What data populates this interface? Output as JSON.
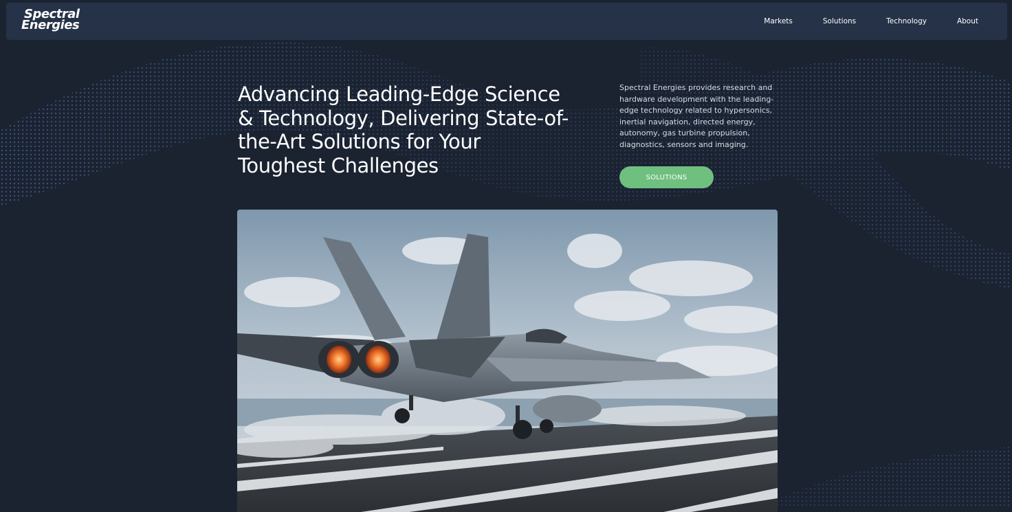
{
  "brand": {
    "logo_line1": "Spectral",
    "logo_line2": "Energies"
  },
  "nav": {
    "items": [
      {
        "label": "Markets"
      },
      {
        "label": "Solutions"
      },
      {
        "label": "Technology"
      },
      {
        "label": "About"
      }
    ]
  },
  "hero": {
    "title_lines": [
      "Advancing Leading-Edge Science",
      "& Technology, Delivering State-of-",
      "the-Art Solutions for Your",
      "Toughest Challenges"
    ],
    "description_lines": [
      "Spectral Energies provides research and",
      "hardware development with the leading-",
      "edge technology related to hypersonics,",
      "inertial navigation, directed energy,",
      "autonomy, gas turbine propulsion,",
      "diagnostics, sensors and imaging."
    ],
    "cta_label": "SOLUTIONS",
    "image_subject": "fighter jet launching from aircraft carrier deck"
  },
  "colors": {
    "background": "#1b2331",
    "navbar": "#253247",
    "accent_green": "#6fbf7f",
    "dot_pattern": "#4a6aa8"
  }
}
